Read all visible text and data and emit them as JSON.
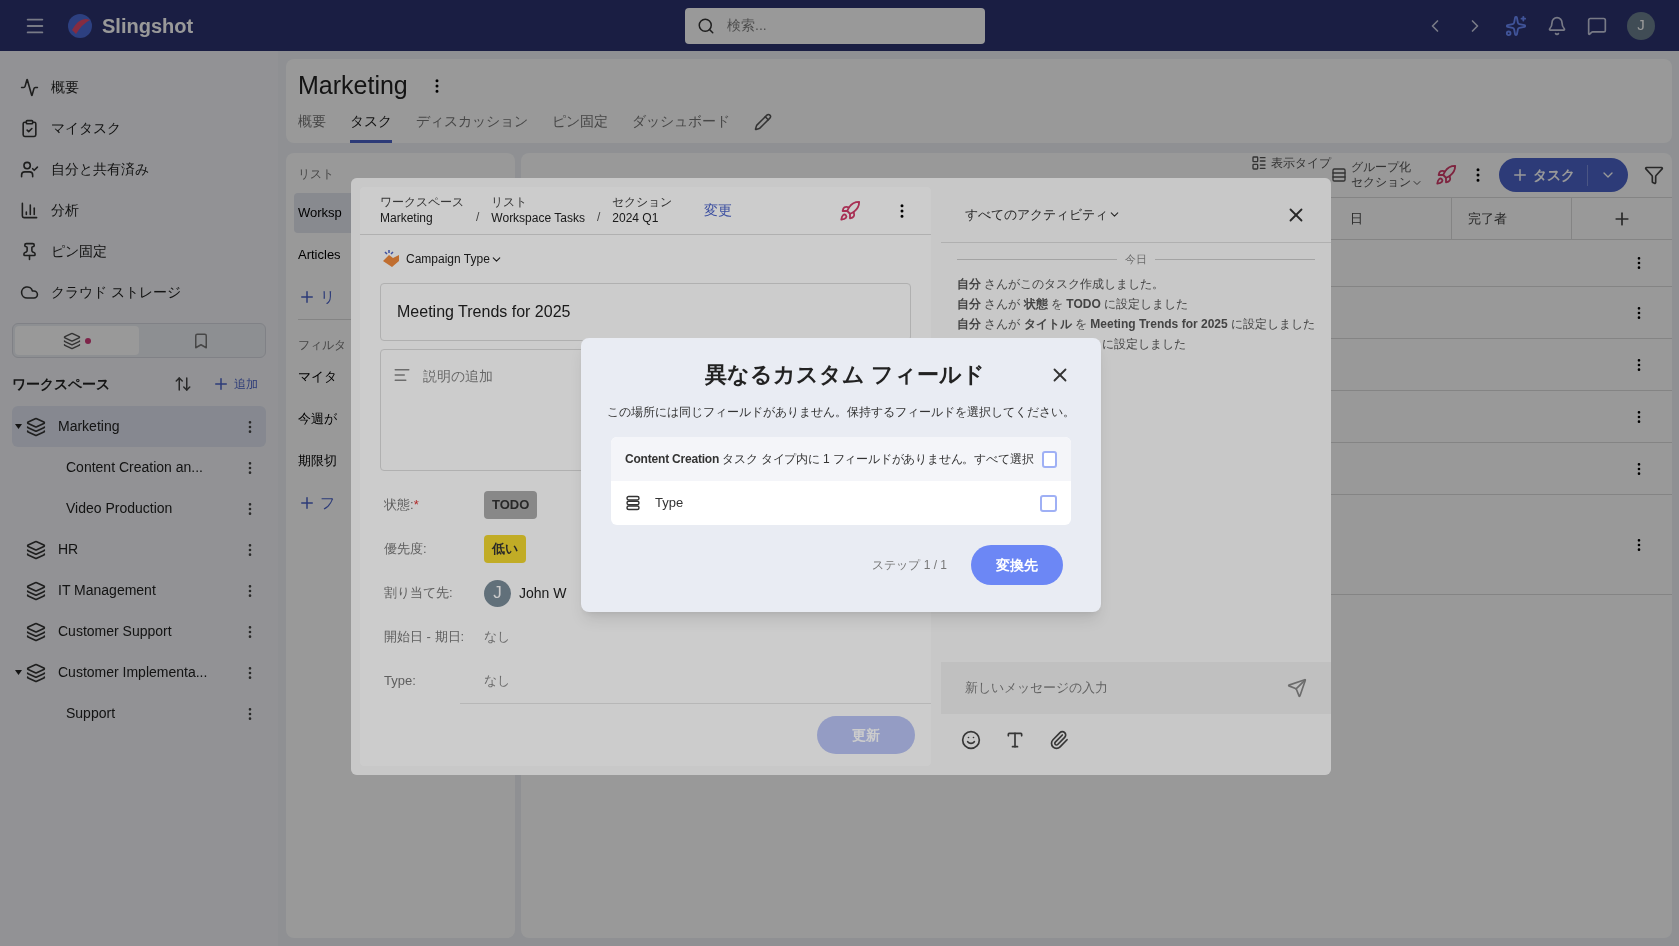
{
  "app": {
    "name": "Slingshot",
    "search_placeholder": "検索...",
    "avatar": "J"
  },
  "sidebar": {
    "nav": [
      {
        "kind": "overview",
        "label": "概要"
      },
      {
        "kind": "tasks",
        "label": "マイタスク"
      },
      {
        "kind": "shared",
        "label": "自分と共有済み"
      },
      {
        "kind": "analytics",
        "label": "分析"
      },
      {
        "kind": "pinned",
        "label": "ピン固定"
      },
      {
        "kind": "cloud",
        "label": "クラウド ストレージ"
      }
    ],
    "tabs": [
      {
        "kind": "workspaces",
        "selected": true,
        "dot": true
      },
      {
        "kind": "bookmarks",
        "selected": false,
        "dot": false
      }
    ],
    "workspaces_title": "ワークスペース",
    "add_label": "追加",
    "workspaces": [
      {
        "name": "Marketing",
        "selected": true,
        "expanded": true,
        "children": [
          {
            "name": "Content Creation an...",
            "selected": false
          },
          {
            "name": "Video Production",
            "selected": false
          }
        ]
      },
      {
        "name": "HR",
        "selected": false
      },
      {
        "name": "IT Management",
        "selected": false
      },
      {
        "name": "Customer Support",
        "selected": false
      },
      {
        "name": "Customer Implementa...",
        "selected": false,
        "expanded": true,
        "children": [
          {
            "name": "Support",
            "selected": false
          }
        ]
      }
    ]
  },
  "project": {
    "title": "Marketing",
    "tabs": [
      {
        "label": "概要",
        "selected": false
      },
      {
        "label": "タスク",
        "selected": true
      },
      {
        "label": "ディスカッション",
        "selected": false
      },
      {
        "label": "ピン固定",
        "selected": false
      },
      {
        "label": "ダッシュボード",
        "selected": false
      }
    ]
  },
  "lists_panel": {
    "heading": "リスト",
    "lists": [
      {
        "name": "Worksp",
        "selected": true
      },
      {
        "name": "Articles",
        "selected": false
      }
    ],
    "add_list": "リ",
    "filters_heading": "フィルタ",
    "filters": [
      "マイタ",
      "今週が",
      "期限切"
    ],
    "add_filter": "フ"
  },
  "table": {
    "view_label": "表示タイプ",
    "group_label": "グループ化",
    "group_value": "セクション",
    "add_task": "タスク",
    "columns": [
      "日",
      "完了者"
    ]
  },
  "task": {
    "breadcrumb": [
      {
        "caption": "ワークスペース",
        "value": "Marketing"
      },
      {
        "caption": "リスト",
        "value": "Workspace Tasks",
        "separator": "/"
      },
      {
        "caption": "セクション",
        "value": "2024 Q1",
        "separator": "/"
      }
    ],
    "change_link": "変更",
    "type_label": "Campaign Type",
    "title": "Meeting Trends for 2025",
    "description_placeholder": "説明の追加",
    "fields": [
      {
        "kind": "status",
        "label": "状態:",
        "required_mark": "*",
        "value": "TODO"
      },
      {
        "kind": "priority",
        "label": "優先度:",
        "value": "低い"
      },
      {
        "kind": "person",
        "label": "割り当て先:",
        "avatar": "J",
        "value": "John W"
      },
      {
        "kind": "text",
        "label": "開始日 - 期日:",
        "value": "なし"
      },
      {
        "kind": "text",
        "label": "Type:",
        "value": "なし"
      }
    ],
    "update_button": "更新",
    "update_disabled": true
  },
  "activity": {
    "filter": "すべてのアクティビティ",
    "day": "今日",
    "entries": [
      "**自分** さんがこのタスク作成しました。",
      "**自分** さんが **状態** を **TODO** に設定しました",
      "**自分** さんが **タイトル** を **Meeting Trends for 2025** に設定しました"
    ],
    "covered_entry": "に設定しました",
    "message_placeholder": "新しいメッセージの入力"
  },
  "dialog": {
    "title": "異なるカスタム フィールド",
    "message": "この場所には同じフィールドがありません。保持するフィールドを選択してください。",
    "group": {
      "heading": "**Content Creation** タスク タイプ内に 1 フィールドがありません。",
      "select_all": "すべて選択",
      "checked": false
    },
    "fields": [
      {
        "name": "Type",
        "checked": false
      }
    ],
    "step": "ステップ 1 / 1",
    "confirm": "変換先"
  }
}
